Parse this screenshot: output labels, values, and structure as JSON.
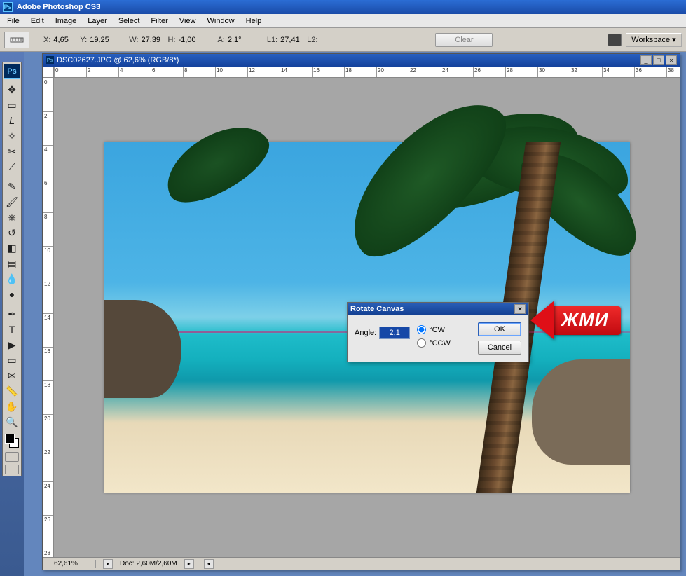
{
  "app": {
    "title": "Adobe Photoshop CS3",
    "ps_icon": "Ps"
  },
  "menu": [
    "File",
    "Edit",
    "Image",
    "Layer",
    "Select",
    "Filter",
    "View",
    "Window",
    "Help"
  ],
  "options": {
    "fields": [
      {
        "label": "X:",
        "value": "4,65"
      },
      {
        "label": "Y:",
        "value": "19,25"
      },
      {
        "label": "W:",
        "value": "27,39"
      },
      {
        "label": "H:",
        "value": "-1,00"
      },
      {
        "label": "A:",
        "value": "2,1°"
      },
      {
        "label": "L1:",
        "value": "27,41"
      },
      {
        "label": "L2:",
        "value": ""
      }
    ],
    "clear": "Clear",
    "workspace": "Workspace ▾"
  },
  "toolbox": {
    "badge": "Ps",
    "tools": [
      {
        "name": "move-tool",
        "glyph": "✥"
      },
      {
        "name": "marquee-tool",
        "glyph": "▭"
      },
      {
        "name": "lasso-tool",
        "glyph": "𝘓"
      },
      {
        "name": "magic-wand-tool",
        "glyph": "✧"
      },
      {
        "name": "crop-tool",
        "glyph": "✂"
      },
      {
        "name": "slice-tool",
        "glyph": "⟋"
      },
      {
        "name": "healing-brush-tool",
        "glyph": "✎"
      },
      {
        "name": "brush-tool",
        "glyph": "🖌"
      },
      {
        "name": "clone-stamp-tool",
        "glyph": "⎈"
      },
      {
        "name": "history-brush-tool",
        "glyph": "↺"
      },
      {
        "name": "eraser-tool",
        "glyph": "◧"
      },
      {
        "name": "gradient-tool",
        "glyph": "▤"
      },
      {
        "name": "blur-tool",
        "glyph": "💧"
      },
      {
        "name": "dodge-tool",
        "glyph": "●"
      },
      {
        "name": "pen-tool",
        "glyph": "✒"
      },
      {
        "name": "type-tool",
        "glyph": "T"
      },
      {
        "name": "path-selection-tool",
        "glyph": "▶"
      },
      {
        "name": "shape-tool",
        "glyph": "▭"
      },
      {
        "name": "notes-tool",
        "glyph": "✉"
      },
      {
        "name": "eyedropper-tool",
        "glyph": "📏"
      },
      {
        "name": "hand-tool",
        "glyph": "✋"
      },
      {
        "name": "zoom-tool",
        "glyph": "🔍"
      }
    ]
  },
  "document": {
    "title": "DSC02627.JPG @ 62,6% (RGB/8*)",
    "ruler_h": [
      "0",
      "2",
      "4",
      "6",
      "8",
      "10",
      "12",
      "14",
      "16",
      "18",
      "20",
      "22",
      "24",
      "26",
      "28",
      "30",
      "32",
      "34",
      "36",
      "38"
    ],
    "ruler_v": [
      "0",
      "2",
      "4",
      "6",
      "8",
      "10",
      "12",
      "14",
      "16",
      "18",
      "20",
      "22",
      "24",
      "26",
      "28"
    ],
    "status": {
      "zoom": "62,61%",
      "doc": "Doc: 2,60M/2,60M"
    }
  },
  "dialog": {
    "title": "Rotate Canvas",
    "angle_label": "Angle:",
    "angle_value": "2,1",
    "cw": "°CW",
    "ccw": "°CCW",
    "ok": "OK",
    "cancel": "Cancel"
  },
  "annotation": {
    "text": "ЖМИ"
  }
}
